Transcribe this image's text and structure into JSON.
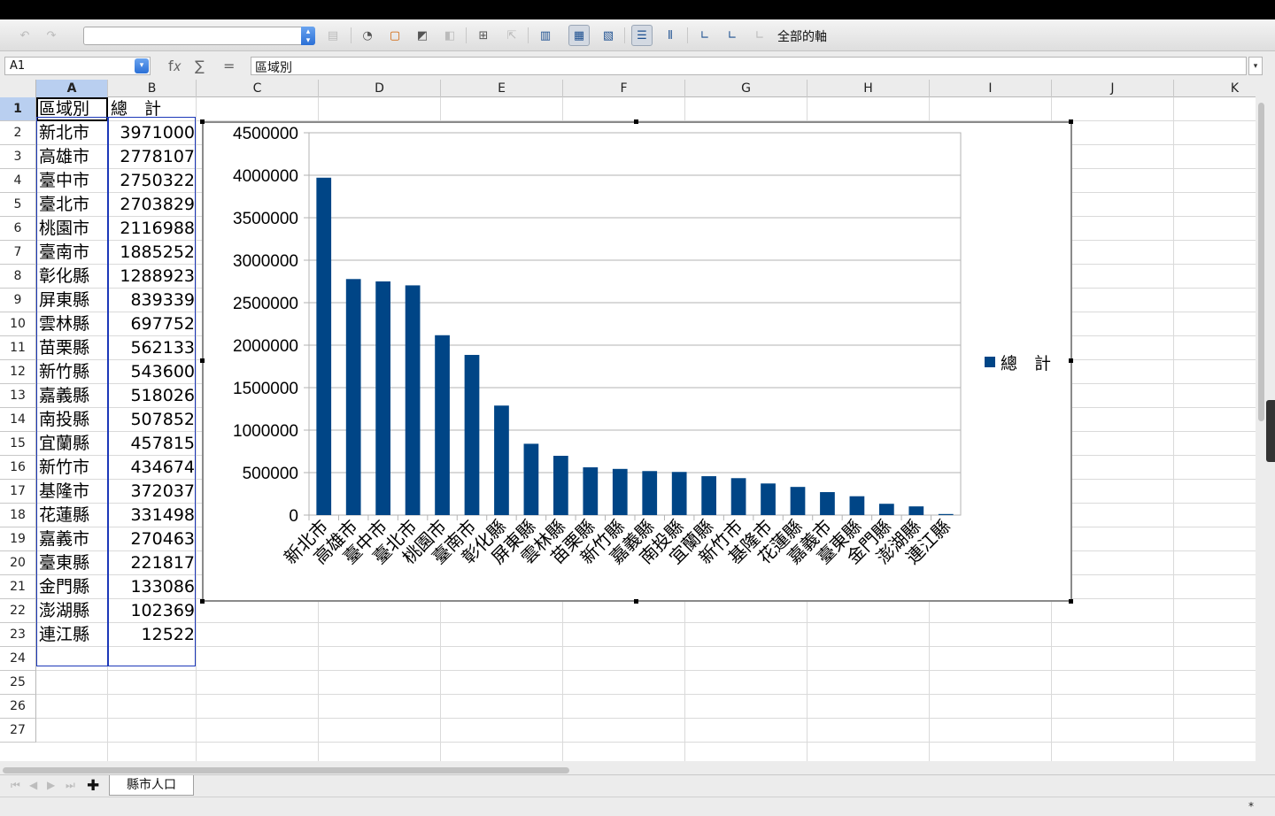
{
  "toolbar": {
    "element_select_value": "",
    "all_axes_label": "全部的軸",
    "icons": [
      "undo-icon",
      "redo-icon",
      "format-selection-icon",
      "chart-type-icon",
      "chart-wall-icon",
      "chart-area-icon",
      "3d-view-icon",
      "data-table-icon",
      "data-ranges-icon",
      "columns-icon",
      "rows-icon",
      "legend-on-off-icon",
      "horizontal-grids-icon",
      "vertical-grids-icon",
      "x-axis-icon",
      "y-axis-icon",
      "z-axis-icon"
    ]
  },
  "formula_bar": {
    "name_box": "A1",
    "fx_symbol": "f𝑥",
    "sum_symbol": "∑",
    "equals_symbol": "=",
    "content": "區域別"
  },
  "columns": [
    "A",
    "B",
    "C",
    "D",
    "E",
    "F",
    "G",
    "H",
    "I",
    "J",
    "K"
  ],
  "selected_columns": [
    "A"
  ],
  "rows": [
    "1",
    "2",
    "3",
    "4",
    "5",
    "6",
    "7",
    "8",
    "9",
    "10",
    "11",
    "12",
    "13",
    "14",
    "15",
    "16",
    "17",
    "18",
    "19",
    "20",
    "21",
    "22",
    "23",
    "24",
    "25",
    "26",
    "27"
  ],
  "selected_rows": [
    "1"
  ],
  "sheet": {
    "header": [
      "區域別",
      "總　計"
    ],
    "data": [
      [
        "新北市",
        "3971000"
      ],
      [
        "高雄市",
        "2778107"
      ],
      [
        "臺中市",
        "2750322"
      ],
      [
        "臺北市",
        "2703829"
      ],
      [
        "桃園市",
        "2116988"
      ],
      [
        "臺南市",
        "1885252"
      ],
      [
        "彰化縣",
        "1288923"
      ],
      [
        "屏東縣",
        "839339"
      ],
      [
        "雲林縣",
        "697752"
      ],
      [
        "苗栗縣",
        "562133"
      ],
      [
        "新竹縣",
        "543600"
      ],
      [
        "嘉義縣",
        "518026"
      ],
      [
        "南投縣",
        "507852"
      ],
      [
        "宜蘭縣",
        "457815"
      ],
      [
        "新竹市",
        "434674"
      ],
      [
        "基隆市",
        "372037"
      ],
      [
        "花蓮縣",
        "331498"
      ],
      [
        "嘉義市",
        "270463"
      ],
      [
        "臺東縣",
        "221817"
      ],
      [
        "金門縣",
        "133086"
      ],
      [
        "澎湖縣",
        "102369"
      ],
      [
        "連江縣",
        "12522"
      ]
    ]
  },
  "chart_data": {
    "type": "bar",
    "categories": [
      "新北市",
      "高雄市",
      "臺中市",
      "臺北市",
      "桃園市",
      "臺南市",
      "彰化縣",
      "屏東縣",
      "雲林縣",
      "苗栗縣",
      "新竹縣",
      "嘉義縣",
      "南投縣",
      "宜蘭縣",
      "新竹市",
      "基隆市",
      "花蓮縣",
      "嘉義市",
      "臺東縣",
      "金門縣",
      "澎湖縣",
      "連江縣"
    ],
    "series": [
      {
        "name": "總　計",
        "values": [
          3971000,
          2778107,
          2750322,
          2703829,
          2116988,
          1885252,
          1288923,
          839339,
          697752,
          562133,
          543600,
          518026,
          507852,
          457815,
          434674,
          372037,
          331498,
          270463,
          221817,
          133086,
          102369,
          12522
        ],
        "color": "#004586"
      }
    ],
    "title": "",
    "xlabel": "",
    "ylabel": "",
    "ylim": [
      0,
      4500000
    ],
    "yticks": [
      "0",
      "500000",
      "1000000",
      "1500000",
      "2000000",
      "2500000",
      "3000000",
      "3500000",
      "4000000",
      "4500000"
    ],
    "grid": true,
    "legend": "right"
  },
  "sheet_tabs": [
    {
      "label": "縣市人口",
      "active": true
    }
  ],
  "status": {
    "modified_indicator": "*"
  }
}
